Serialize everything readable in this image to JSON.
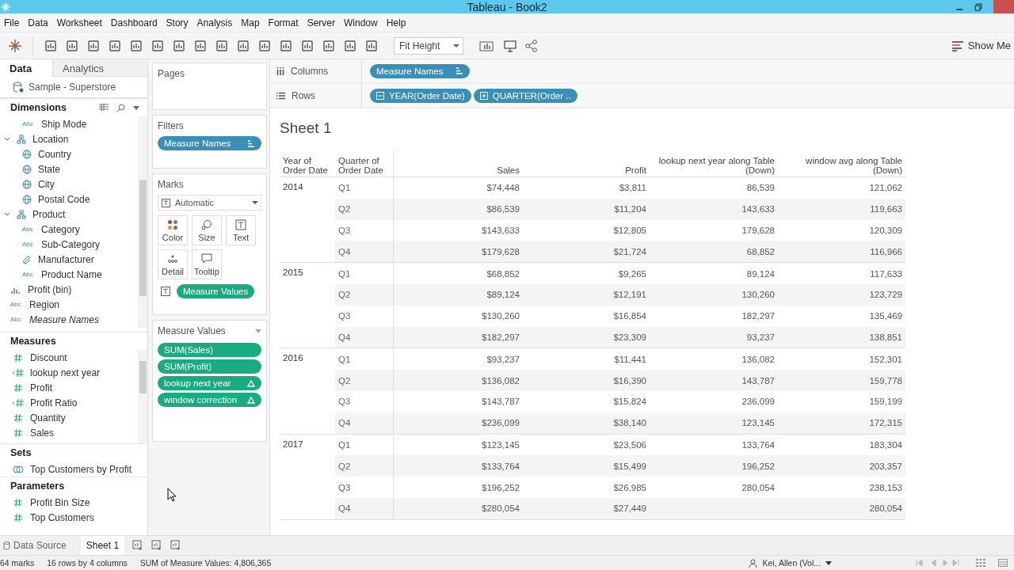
{
  "window": {
    "title": "Tableau - Book2"
  },
  "menu": [
    "File",
    "Data",
    "Worksheet",
    "Dashboard",
    "Story",
    "Analysis",
    "Map",
    "Format",
    "Server",
    "Window",
    "Help"
  ],
  "toolbar": {
    "fit": "Fit Height",
    "show_me": "Show Me"
  },
  "data_pane": {
    "tabs": [
      {
        "label": "Data",
        "selected": true
      },
      {
        "label": "Analytics",
        "selected": false
      }
    ],
    "datasource": "Sample - Superstore",
    "dimensions": {
      "title": "Dimensions",
      "items": [
        {
          "label": "Ship Mode",
          "kind": "abc",
          "type": "Abc"
        },
        {
          "label": "Location",
          "kind": "hierarchy",
          "expanded": true,
          "children": [
            {
              "label": "Country",
              "kind": "geo"
            },
            {
              "label": "State",
              "kind": "geo"
            },
            {
              "label": "City",
              "kind": "geo"
            },
            {
              "label": "Postal Code",
              "kind": "geo"
            }
          ]
        },
        {
          "label": "Product",
          "kind": "hierarchy",
          "expanded": true,
          "children": [
            {
              "label": "Category",
              "kind": "abc",
              "type": "Abc"
            },
            {
              "label": "Sub-Category",
              "kind": "abc",
              "type": "Abc"
            },
            {
              "label": "Manufacturer",
              "kind": "group"
            },
            {
              "label": "Product Name",
              "kind": "abc",
              "type": "Abc"
            }
          ]
        },
        {
          "label": "Profit (bin)",
          "kind": "bin"
        },
        {
          "label": "Region",
          "kind": "abc",
          "type": "Abc"
        },
        {
          "label": "Measure Names",
          "kind": "abc",
          "type": "Abc",
          "italic": true
        }
      ]
    },
    "measures": {
      "title": "Measures",
      "items": [
        {
          "label": "Discount",
          "kind": "measure"
        },
        {
          "label": "lookup next year",
          "kind": "calc"
        },
        {
          "label": "Profit",
          "kind": "measure"
        },
        {
          "label": "Profit Ratio",
          "kind": "calc"
        },
        {
          "label": "Quantity",
          "kind": "measure"
        },
        {
          "label": "Sales",
          "kind": "measure"
        }
      ]
    },
    "sets": {
      "title": "Sets",
      "items": [
        {
          "label": "Top Customers by Profit",
          "kind": "set"
        }
      ]
    },
    "parameters": {
      "title": "Parameters",
      "items": [
        {
          "label": "Profit Bin Size",
          "kind": "measure"
        },
        {
          "label": "Top Customers",
          "kind": "measure"
        }
      ]
    }
  },
  "pages": {
    "title": "Pages"
  },
  "filters": {
    "title": "Filters",
    "pills": [
      {
        "label": "Measure Names",
        "sorted": true
      }
    ]
  },
  "marks": {
    "title": "Marks",
    "type": "Automatic",
    "cards": [
      "Color",
      "Size",
      "Text",
      "Detail",
      "Tooltip"
    ],
    "pill": "Measure Values"
  },
  "measure_values": {
    "title": "Measure Values",
    "pills": [
      {
        "label": "SUM(Sales)",
        "calc": false
      },
      {
        "label": "SUM(Profit)",
        "calc": false
      },
      {
        "label": "lookup next year",
        "calc": true
      },
      {
        "label": "window correction",
        "calc": true
      }
    ]
  },
  "shelves": [
    {
      "label": "Columns",
      "kind": "columns",
      "pills": [
        {
          "label": "Measure Names",
          "sorted": true
        }
      ]
    },
    {
      "label": "Rows",
      "kind": "rows",
      "pills": [
        {
          "label": "YEAR(Order Date)",
          "sorted": false,
          "expanded": true
        },
        {
          "label": "QUARTER(Order ..",
          "sorted": false,
          "expanded": false
        }
      ]
    }
  ],
  "sheet": {
    "title": "Sheet 1",
    "headers": [
      "Year of Order Date",
      "Quarter of Order Date",
      "Sales",
      "Profit",
      "lookup next year along Table (Down)",
      "window avg along Table (Down)"
    ],
    "groups": [
      {
        "year": "2014",
        "rows": [
          {
            "quarter": "Q1",
            "sales": "$74,448",
            "profit": "$3,811",
            "lookup": "86,539",
            "window": "121,062"
          },
          {
            "quarter": "Q2",
            "sales": "$86,539",
            "profit": "$11,204",
            "lookup": "143,633",
            "window": "119,663"
          },
          {
            "quarter": "Q3",
            "sales": "$143,633",
            "profit": "$12,805",
            "lookup": "179,628",
            "window": "120,309"
          },
          {
            "quarter": "Q4",
            "sales": "$179,628",
            "profit": "$21,724",
            "lookup": "68,852",
            "window": "116,966"
          }
        ]
      },
      {
        "year": "2015",
        "rows": [
          {
            "quarter": "Q1",
            "sales": "$68,852",
            "profit": "$9,265",
            "lookup": "89,124",
            "window": "117,633"
          },
          {
            "quarter": "Q2",
            "sales": "$89,124",
            "profit": "$12,191",
            "lookup": "130,260",
            "window": "123,729"
          },
          {
            "quarter": "Q3",
            "sales": "$130,260",
            "profit": "$16,854",
            "lookup": "182,297",
            "window": "135,469"
          },
          {
            "quarter": "Q4",
            "sales": "$182,297",
            "profit": "$23,309",
            "lookup": "93,237",
            "window": "138,851"
          }
        ]
      },
      {
        "year": "2016",
        "rows": [
          {
            "quarter": "Q1",
            "sales": "$93,237",
            "profit": "$11,441",
            "lookup": "136,082",
            "window": "152,301"
          },
          {
            "quarter": "Q2",
            "sales": "$136,082",
            "profit": "$16,390",
            "lookup": "143,787",
            "window": "159,778"
          },
          {
            "quarter": "Q3",
            "sales": "$143,787",
            "profit": "$15,824",
            "lookup": "236,099",
            "window": "159,199"
          },
          {
            "quarter": "Q4",
            "sales": "$236,099",
            "profit": "$38,140",
            "lookup": "123,145",
            "window": "172,315"
          }
        ]
      },
      {
        "year": "2017",
        "rows": [
          {
            "quarter": "Q1",
            "sales": "$123,145",
            "profit": "$23,506",
            "lookup": "133,764",
            "window": "183,304"
          },
          {
            "quarter": "Q2",
            "sales": "$133,764",
            "profit": "$15,499",
            "lookup": "196,252",
            "window": "203,357"
          },
          {
            "quarter": "Q3",
            "sales": "$196,252",
            "profit": "$26,985",
            "lookup": "280,054",
            "window": "238,153"
          },
          {
            "quarter": "Q4",
            "sales": "$280,054",
            "profit": "$27,449",
            "window": "280,054"
          }
        ]
      }
    ]
  },
  "sheet_tabs": [
    {
      "label": "Data Source",
      "kind": "datasource",
      "selected": false
    },
    {
      "label": "Sheet 1",
      "kind": "sheet",
      "selected": true
    }
  ],
  "status": {
    "marks": "64 marks",
    "size": "16 rows by 4 columns",
    "sum": "SUM of Measure Values: 4,806,365",
    "user": "Kei, Allen (Vol..."
  }
}
